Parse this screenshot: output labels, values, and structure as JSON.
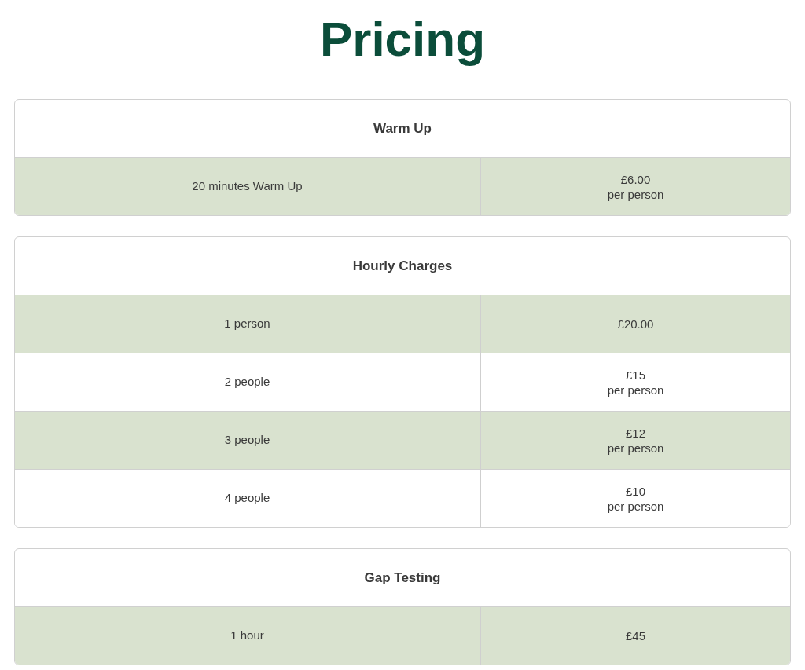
{
  "title": "Pricing",
  "tables": [
    {
      "heading": "Warm Up",
      "rows": [
        {
          "item": "20 minutes Warm Up",
          "price": "£6.00",
          "unit": "per person"
        }
      ]
    },
    {
      "heading": "Hourly Charges",
      "rows": [
        {
          "item": "1 person",
          "price": "£20.00"
        },
        {
          "item": "2 people",
          "price": "£15",
          "unit": "per person"
        },
        {
          "item": "3 people",
          "price": "£12",
          "unit": "per person"
        },
        {
          "item": "4 people",
          "price": "£10",
          "unit": "per person"
        }
      ]
    },
    {
      "heading": "Gap Testing",
      "rows": [
        {
          "item": "1 hour",
          "price": "£45"
        }
      ]
    }
  ]
}
